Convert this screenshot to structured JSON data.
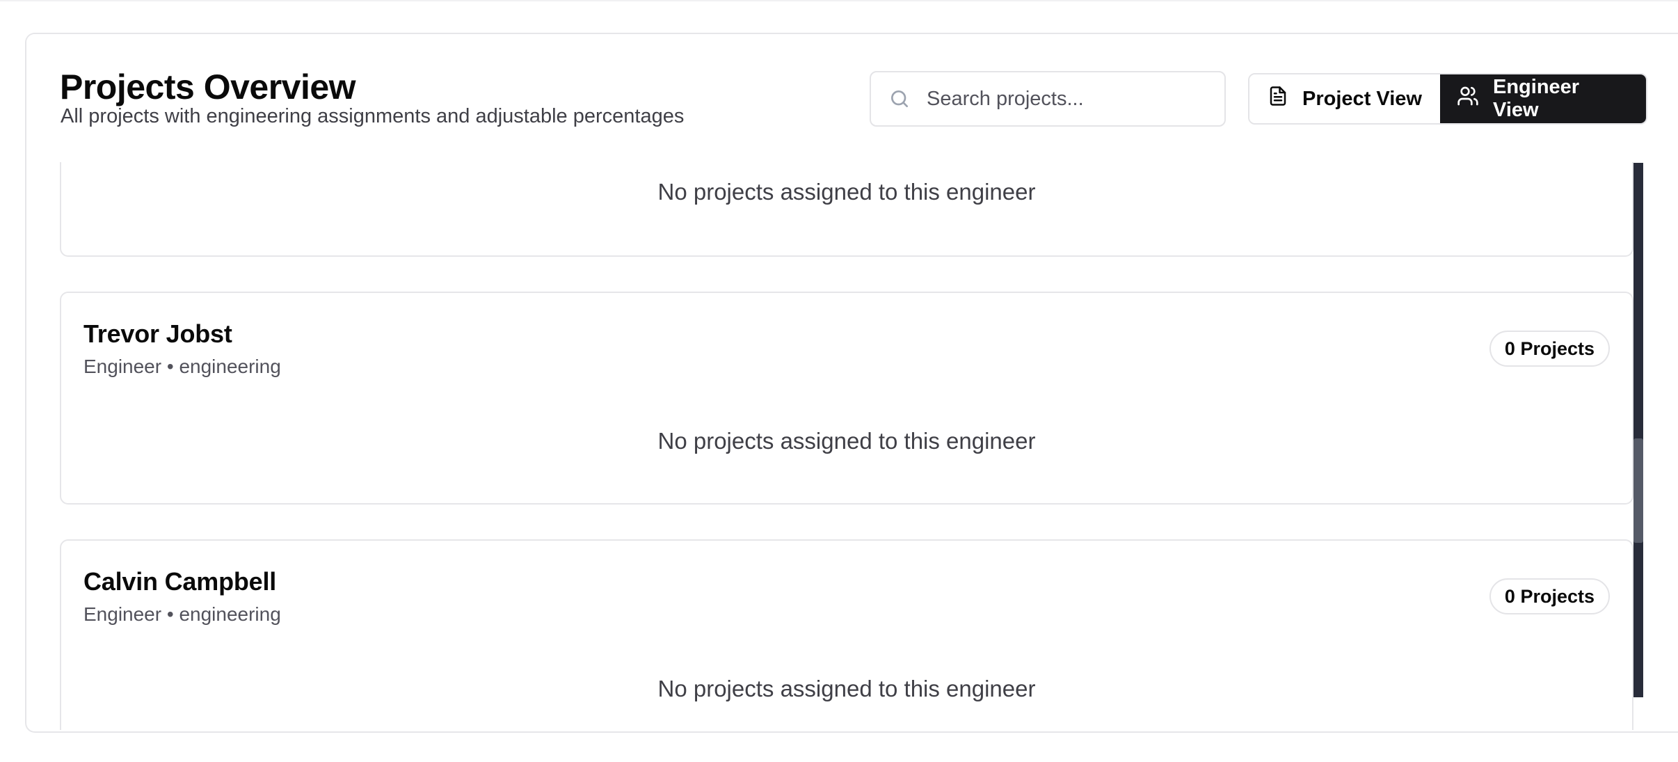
{
  "header": {
    "title": "Projects Overview",
    "subtitle": "All projects with engineering assignments and adjustable percentages"
  },
  "search": {
    "placeholder": "Search projects...",
    "value": "",
    "icon": "search-icon"
  },
  "view_toggle": {
    "project_view_label": "Project View",
    "project_view_icon": "file-text-icon",
    "engineer_view_label": "Engineer View",
    "engineer_view_icon": "users-icon",
    "active": "Engineer View"
  },
  "engineers": [
    {
      "name": "",
      "meta": "",
      "badge": "",
      "empty_message": "No projects assigned to this engineer"
    },
    {
      "name": "Trevor Jobst",
      "meta": "Engineer • engineering",
      "badge": "0 Projects",
      "empty_message": "No projects assigned to this engineer"
    },
    {
      "name": "Calvin Campbell",
      "meta": "Engineer • engineering",
      "badge": "0 Projects",
      "empty_message": "No projects assigned to this engineer"
    }
  ],
  "colors": {
    "accent_dark": "#18181b",
    "border": "#e6e6e9",
    "muted_text": "#52525b",
    "scrollbar_track": "#282c3a",
    "scrollbar_thumb": "#555a67"
  }
}
